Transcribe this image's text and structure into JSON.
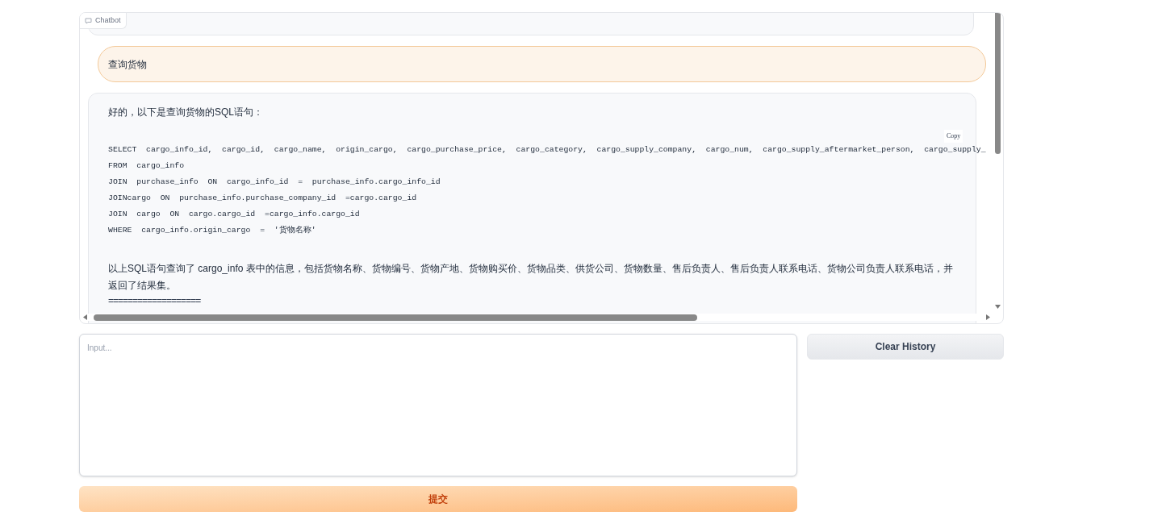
{
  "chatbot_label": "Chatbot",
  "messages": [
    {
      "kind": "user",
      "text": "查询货物"
    },
    {
      "kind": "bot",
      "intro": "好的，以下是查询货物的SQL语句：",
      "copy_label": "Copy",
      "code_lines": [
        "SELECT  cargo_info_id,  cargo_id,  cargo_name,  origin_cargo,  cargo_purchase_price,  cargo_category,  cargo_supply_company,  cargo_num,  cargo_supply_aftermarket_person,  cargo_supply_",
        "FROM  cargo_info",
        "JOIN  purchase_info  ON  cargo_info_id  =  purchase_info.cargo_info_id",
        "JOINcargo  ON  purchase_info.purchase_company_id  =cargo.cargo_id",
        "JOIN  cargo  ON  cargo.cargo_id  =cargo_info.cargo_id",
        "WHERE  cargo_info.origin_cargo  =  '货物名称'"
      ],
      "summary": "以上SQL语句查询了 cargo_info 表中的信息，包括货物名称、货物编号、货物产地、货物购买价、货物品类、供货公司、货物数量、售后负责人、售后负责人联系电话、货物公司负责人联系电话，并返回了结果集。",
      "separator": "==================="
    }
  ],
  "input": {
    "placeholder": "Input..."
  },
  "clear_button": "Clear History",
  "submit_button": "提交"
}
